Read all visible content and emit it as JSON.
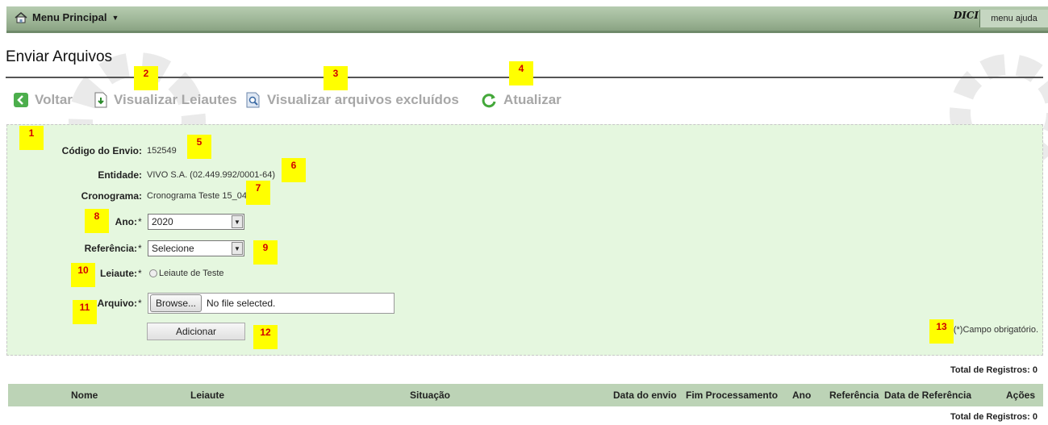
{
  "header": {
    "menu_label": "Menu Principal",
    "brand": "DICI",
    "help_label": "menu ajuda"
  },
  "page": {
    "title": "Enviar Arquivos"
  },
  "toolbar": {
    "back_label": "Voltar",
    "view_layouts_label": "Visualizar Leiautes",
    "view_deleted_label": "Visualizar arquivos excluídos",
    "refresh_label": "Atualizar"
  },
  "form": {
    "codigo_label": "Código do Envio:",
    "codigo_value": "152549",
    "entidade_label": "Entidade:",
    "entidade_value": "VIVO S.A. (02.449.992/0001-64)",
    "cronograma_label": "Cronograma:",
    "cronograma_value": "Cronograma Teste 15_04",
    "ano_label": "Ano:",
    "ano_value": "2020",
    "referencia_label": "Referência:",
    "referencia_value": "Selecione",
    "leiaute_label": "Leiaute:",
    "leiaute_option": "Leiaute de Teste",
    "arquivo_label": "Arquivo:",
    "browse_label": "Browse...",
    "file_status": "No file selected.",
    "add_button": "Adicionar",
    "required_marker": "*",
    "required_note": "(*)Campo obrigatório."
  },
  "callouts": [
    "1",
    "2",
    "3",
    "4",
    "5",
    "6",
    "7",
    "8",
    "9",
    "10",
    "11",
    "12",
    "13"
  ],
  "table": {
    "total_top": "Total de Registros: 0",
    "total_bottom": "Total de Registros: 0",
    "columns": [
      "Nome",
      "Leiaute",
      "Situação",
      "Data do envio",
      "Fim Processamento",
      "Ano",
      "Referência",
      "Data de Referência",
      "Ações"
    ]
  },
  "colors": {
    "header_bar": "#9db596",
    "panel_bg": "#e5f7df",
    "table_header": "#bcd3b6",
    "callout_bg": "#ffff00",
    "callout_text": "#d10000",
    "toolbar_text": "#a7a7a7"
  }
}
